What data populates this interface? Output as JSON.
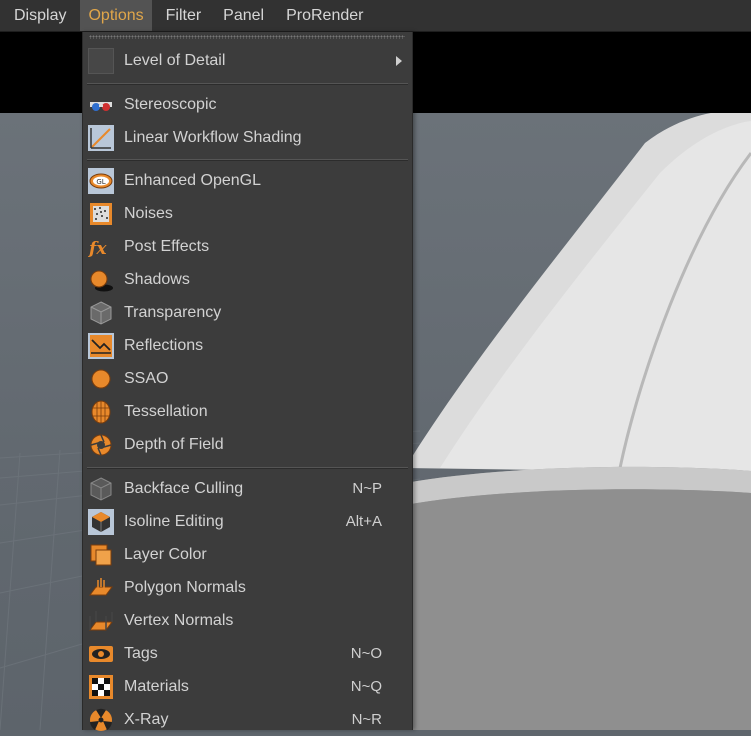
{
  "menubar": {
    "items": [
      {
        "label": "Display"
      },
      {
        "label": "Options"
      },
      {
        "label": "Filter"
      },
      {
        "label": "Panel"
      },
      {
        "label": "ProRender"
      }
    ],
    "active": "Options"
  },
  "menu": {
    "items": [
      {
        "label": "Level of Detail",
        "icon": "level-of-detail-icon",
        "submenu": true
      },
      {
        "label": "Stereoscopic",
        "icon": "stereoscopic-glasses-icon"
      },
      {
        "label": "Linear Workflow Shading",
        "icon": "linear-workflow-icon"
      },
      {
        "label": "Enhanced OpenGL",
        "icon": "opengl-icon"
      },
      {
        "label": "Noises",
        "icon": "noises-icon"
      },
      {
        "label": "Post Effects",
        "icon": "fx-icon"
      },
      {
        "label": "Shadows",
        "icon": "shadows-icon"
      },
      {
        "label": "Transparency",
        "icon": "transparency-cube-icon"
      },
      {
        "label": "Reflections",
        "icon": "reflections-icon"
      },
      {
        "label": "SSAO",
        "icon": "ssao-sphere-icon"
      },
      {
        "label": "Tessellation",
        "icon": "tessellation-icon"
      },
      {
        "label": "Depth of Field",
        "icon": "aperture-icon"
      },
      {
        "label": "Backface Culling",
        "icon": "backface-cube-icon",
        "shortcut": "N~P"
      },
      {
        "label": "Isoline Editing",
        "icon": "isoline-cube-icon",
        "shortcut": "Alt+A"
      },
      {
        "label": "Layer Color",
        "icon": "layer-color-icon"
      },
      {
        "label": "Polygon Normals",
        "icon": "polygon-normals-icon"
      },
      {
        "label": "Vertex Normals",
        "icon": "vertex-normals-icon"
      },
      {
        "label": "Tags",
        "icon": "eye-icon",
        "shortcut": "N~O"
      },
      {
        "label": "Materials",
        "icon": "checker-icon",
        "shortcut": "N~Q"
      },
      {
        "label": "X-Ray",
        "icon": "xray-icon",
        "shortcut": "N~R"
      }
    ]
  },
  "colors": {
    "accent": "#e0a64a",
    "menu_bg": "#3c3c3c",
    "menubar_bg": "#323232",
    "icon_orange": "#e8892b"
  }
}
